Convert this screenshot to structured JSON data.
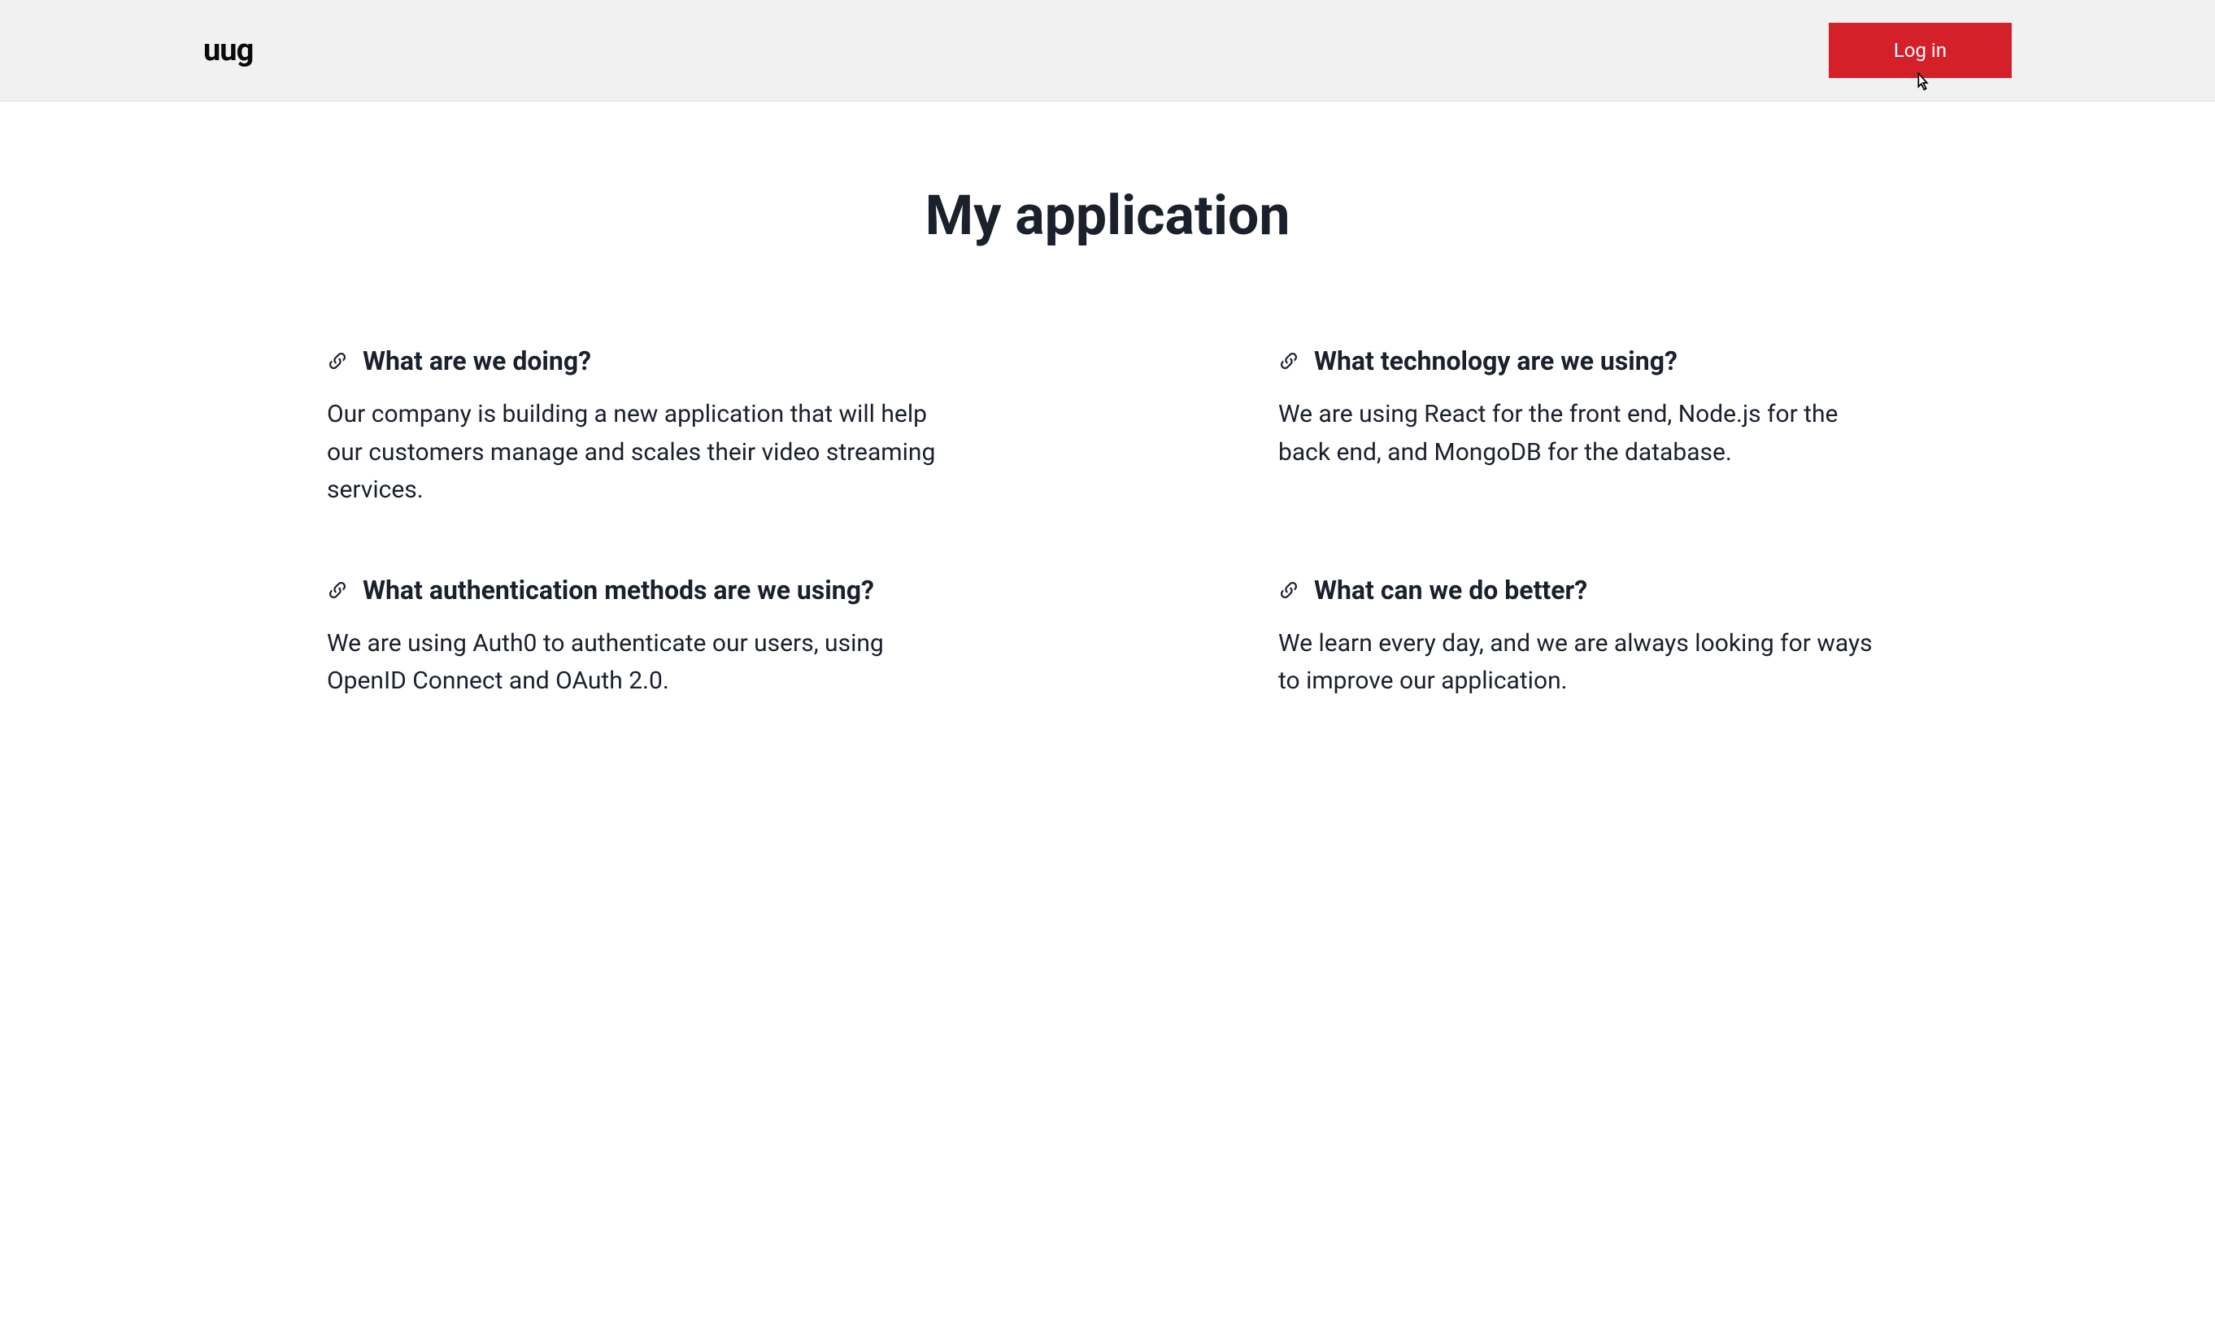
{
  "header": {
    "logo_text": "uug",
    "login_label": "Log in"
  },
  "main": {
    "title": "My application",
    "sections": [
      {
        "heading": "What are we doing?",
        "body": "Our company is building a new application that will help our customers manage and scales their video streaming services."
      },
      {
        "heading": "What technology are we using?",
        "body": "We are using React for the front end, Node.js for the back end, and MongoDB for the database."
      },
      {
        "heading": "What authentication methods are we using?",
        "body": "We are using Auth0 to authenticate our users, using OpenID Connect and OAuth 2.0."
      },
      {
        "heading": "What can we do better?",
        "body": "We learn every day, and we are always looking for ways to improve our application."
      }
    ]
  },
  "colors": {
    "accent": "#d32029",
    "header_bg": "#f1f1f1",
    "text": "#1a202c"
  }
}
